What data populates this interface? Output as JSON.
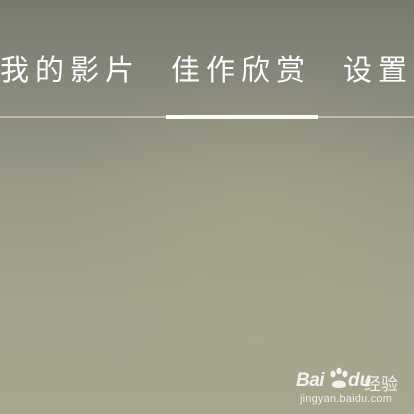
{
  "tabs": [
    {
      "label": "我的影片",
      "active": false
    },
    {
      "label": "佳作欣赏",
      "active": true
    },
    {
      "label": "设置",
      "active": false
    }
  ],
  "watermark": {
    "brand_left": "Bai",
    "brand_right": "du",
    "product": "经验",
    "url": "jingyan.baidu.com"
  },
  "colors": {
    "tab_text": "#ffffff",
    "active_indicator": "#ffffff",
    "background_top": "#7a7a6c",
    "background_bottom": "#a8a58e"
  }
}
